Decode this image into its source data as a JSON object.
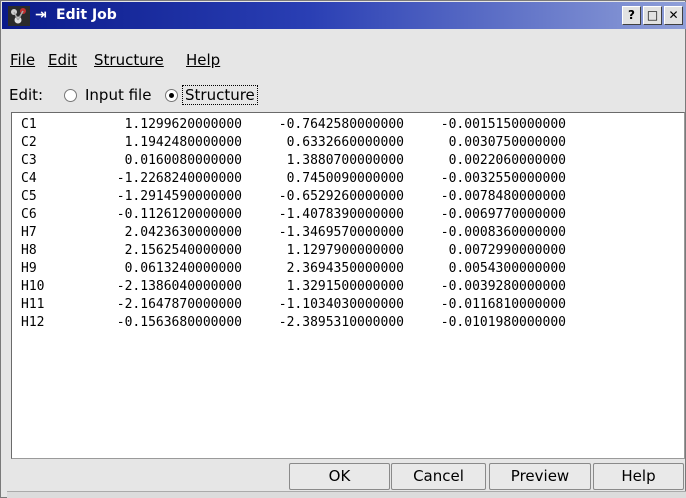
{
  "window": {
    "title": "Edit Job",
    "pin_glyph": "⇥",
    "title_buttons": [
      "?",
      "□",
      "✕"
    ]
  },
  "menu": {
    "items": [
      "File",
      "Edit",
      "Structure",
      "Help"
    ]
  },
  "edit_mode": {
    "label": "Edit:",
    "options": [
      "Input file",
      "Structure"
    ],
    "selected": "Structure"
  },
  "structure": {
    "rows": [
      [
        "C1",
        "1.1299620000000",
        "-0.7642580000000",
        "-0.0015150000000"
      ],
      [
        "C2",
        "1.1942480000000",
        "0.6332660000000",
        "0.0030750000000"
      ],
      [
        "C3",
        "0.0160080000000",
        "1.3880700000000",
        "0.0022060000000"
      ],
      [
        "C4",
        "-1.2268240000000",
        "0.7450090000000",
        "-0.0032550000000"
      ],
      [
        "C5",
        "-1.2914590000000",
        "-0.6529260000000",
        "-0.0078480000000"
      ],
      [
        "C6",
        "-0.1126120000000",
        "-1.4078390000000",
        "-0.0069770000000"
      ],
      [
        "H7",
        "2.0423630000000",
        "-1.3469570000000",
        "-0.0008360000000"
      ],
      [
        "H8",
        "2.1562540000000",
        "1.1297900000000",
        "0.0072990000000"
      ],
      [
        "H9",
        "0.0613240000000",
        "2.3694350000000",
        "0.0054300000000"
      ],
      [
        "H10",
        "-2.1386040000000",
        "1.3291500000000",
        "-0.0039280000000"
      ],
      [
        "H11",
        "-2.1647870000000",
        "-1.1034030000000",
        "-0.0116810000000"
      ],
      [
        "H12",
        "-0.1563680000000",
        "-2.3895310000000",
        "-0.0101980000000"
      ]
    ]
  },
  "buttons": {
    "ok": "OK",
    "cancel": "Cancel",
    "preview": "Preview",
    "help": "Help"
  },
  "colors": {
    "titlebar_start": "#0a1a8a",
    "titlebar_end": "#8f9fd8",
    "window_bg": "#e6e6e6"
  }
}
